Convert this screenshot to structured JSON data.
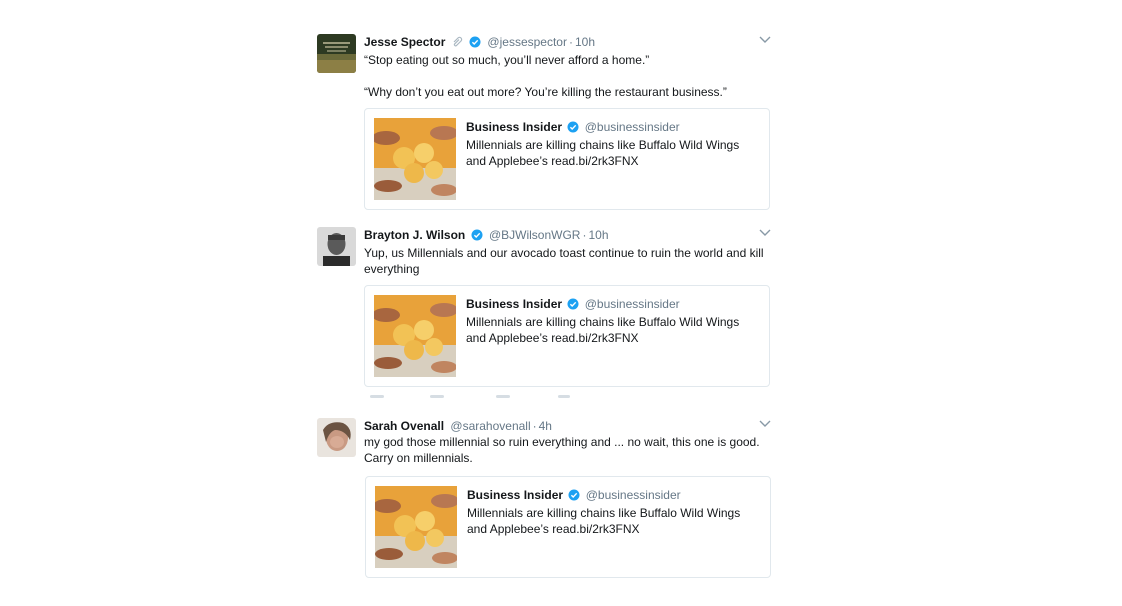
{
  "colors": {
    "verified": "#1da1f2",
    "text": "#14171a",
    "muted": "#657786",
    "border": "#e1e8ed"
  },
  "tweets": [
    {
      "fullname": "Jesse Spector",
      "handle": "@jessespector",
      "time": "10h",
      "has_clip": true,
      "text_lines": [
        "“Stop eating out so much, you’ll never afford a home.”",
        "",
        "“Why don’t you eat out more? You’re killing the restaurant business.”"
      ],
      "card": {
        "name": "Business Insider",
        "handle": "@businessinsider",
        "text": "Millennials are killing chains like Buffalo Wild Wings and Applebee’s read.bi/2rk3FNX"
      }
    },
    {
      "fullname": "Brayton J. Wilson",
      "handle": "@BJWilsonWGR",
      "time": "10h",
      "has_clip": false,
      "text_lines": [
        "Yup, us Millennials and our avocado toast continue to ruin the world and kill everything"
      ],
      "card": {
        "name": "Business Insider",
        "handle": "@businessinsider",
        "text": "Millennials are killing chains like Buffalo Wild Wings and Applebee’s read.bi/2rk3FNX"
      }
    },
    {
      "fullname": "Sarah Ovenall",
      "handle": "@sarahovenall",
      "time": "4h",
      "has_clip": false,
      "text_lines": [
        "my god those millennial so ruin everything and ... no wait, this one is good. Carry on millennials."
      ],
      "card": {
        "name": "Business Insider",
        "handle": "@businessinsider",
        "text": "Millennials are killing chains like Buffalo Wild Wings and Applebee’s read.bi/2rk3FNX"
      }
    }
  ],
  "icons": {
    "verified": "verified-badge-icon",
    "caret": "chevron-down-icon",
    "clip": "paperclip-icon"
  }
}
